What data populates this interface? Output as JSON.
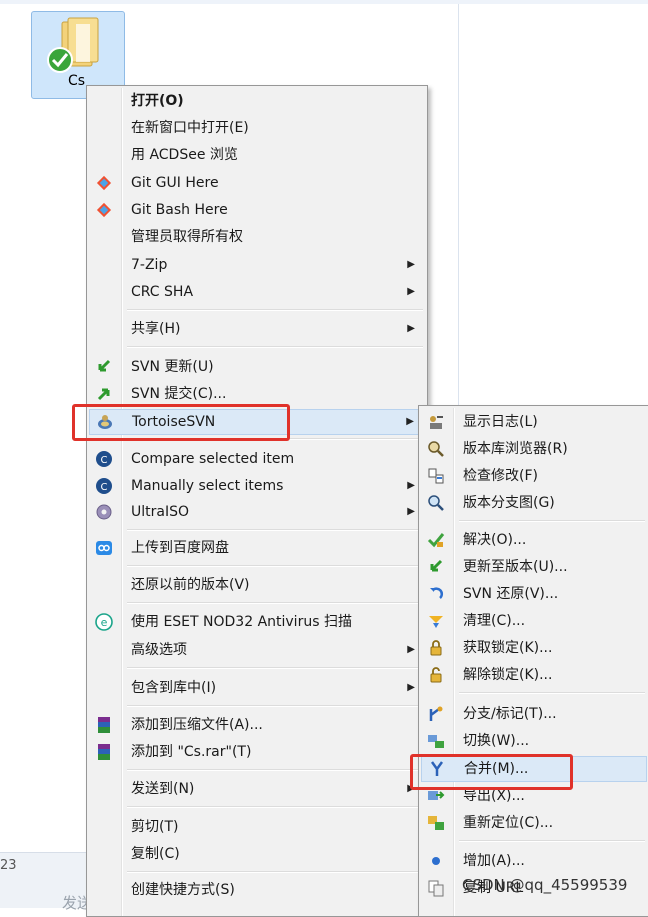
{
  "desktop": {
    "folder_label": "Cs",
    "bottom_text": "23",
    "ghost_text": "发送到(N)"
  },
  "main_menu": {
    "items": [
      {
        "label": "打开(O)",
        "icon": "none"
      },
      {
        "label": "在新窗口中打开(E)",
        "icon": "none"
      },
      {
        "label": "用 ACDSee 浏览",
        "icon": "none"
      },
      {
        "label": "Git GUI Here",
        "icon": "git-icon"
      },
      {
        "label": "Git Bash Here",
        "icon": "git-icon"
      },
      {
        "label": "管理员取得所有权",
        "icon": "none"
      },
      {
        "label": "7-Zip",
        "icon": "none"
      },
      {
        "label": "CRC SHA",
        "icon": "none"
      },
      {
        "label": "共享(H)",
        "icon": "none"
      },
      {
        "label": "SVN 更新(U)",
        "icon": "svn-update-icon"
      },
      {
        "label": "SVN 提交(C)...",
        "icon": "svn-commit-icon"
      },
      {
        "label": "TortoiseSVN",
        "icon": "tortoisesvn-icon"
      },
      {
        "label": "Compare selected item",
        "icon": "compare-icon"
      },
      {
        "label": "Manually select items",
        "icon": "compare-icon"
      },
      {
        "label": "UltraISO",
        "icon": "ultraiso-icon"
      },
      {
        "label": "上传到百度网盘",
        "icon": "baidu-cloud-icon"
      },
      {
        "label": "还原以前的版本(V)",
        "icon": "none"
      },
      {
        "label": "使用 ESET NOD32 Antivirus 扫描",
        "icon": "eset-icon"
      },
      {
        "label": "高级选项",
        "icon": "none"
      },
      {
        "label": "包含到库中(I)",
        "icon": "none"
      },
      {
        "label": "添加到压缩文件(A)...",
        "icon": "winrar-icon"
      },
      {
        "label": "添加到 \"Cs.rar\"(T)",
        "icon": "winrar-icon"
      },
      {
        "label": "发送到(N)",
        "icon": "none"
      },
      {
        "label": "剪切(T)",
        "icon": "none"
      },
      {
        "label": "复制(C)",
        "icon": "none"
      },
      {
        "label": "创建快捷方式(S)",
        "icon": "none"
      }
    ]
  },
  "sub_menu": {
    "items": [
      {
        "label": "显示日志(L)",
        "icon": "show-log-icon"
      },
      {
        "label": "版本库浏览器(R)",
        "icon": "repo-browser-icon"
      },
      {
        "label": "检查修改(F)",
        "icon": "check-modifications-icon"
      },
      {
        "label": "版本分支图(G)",
        "icon": "revision-graph-icon"
      },
      {
        "label": "解决(O)...",
        "icon": "resolve-icon"
      },
      {
        "label": "更新至版本(U)...",
        "icon": "update-to-revision-icon"
      },
      {
        "label": "SVN 还原(V)...",
        "icon": "revert-icon"
      },
      {
        "label": "清理(C)...",
        "icon": "cleanup-icon"
      },
      {
        "label": "获取锁定(K)...",
        "icon": "get-lock-icon"
      },
      {
        "label": "解除锁定(K)...",
        "icon": "release-lock-icon"
      },
      {
        "label": "分支/标记(T)...",
        "icon": "branch-tag-icon"
      },
      {
        "label": "切换(W)...",
        "icon": "switch-icon"
      },
      {
        "label": "合并(M)...",
        "icon": "merge-icon"
      },
      {
        "label": "导出(X)...",
        "icon": "export-icon"
      },
      {
        "label": "重新定位(C)...",
        "icon": "relocate-icon"
      },
      {
        "label": "增加(A)...",
        "icon": "add-icon"
      },
      {
        "label": "复制 URL",
        "icon": "copy-url-icon"
      }
    ]
  },
  "watermark": "CSDN @qq_45599539",
  "colors": {
    "highlight_box": "#e0322a",
    "menu_bg": "#f1f1f1",
    "hover_bg": "#dbe9f7"
  }
}
